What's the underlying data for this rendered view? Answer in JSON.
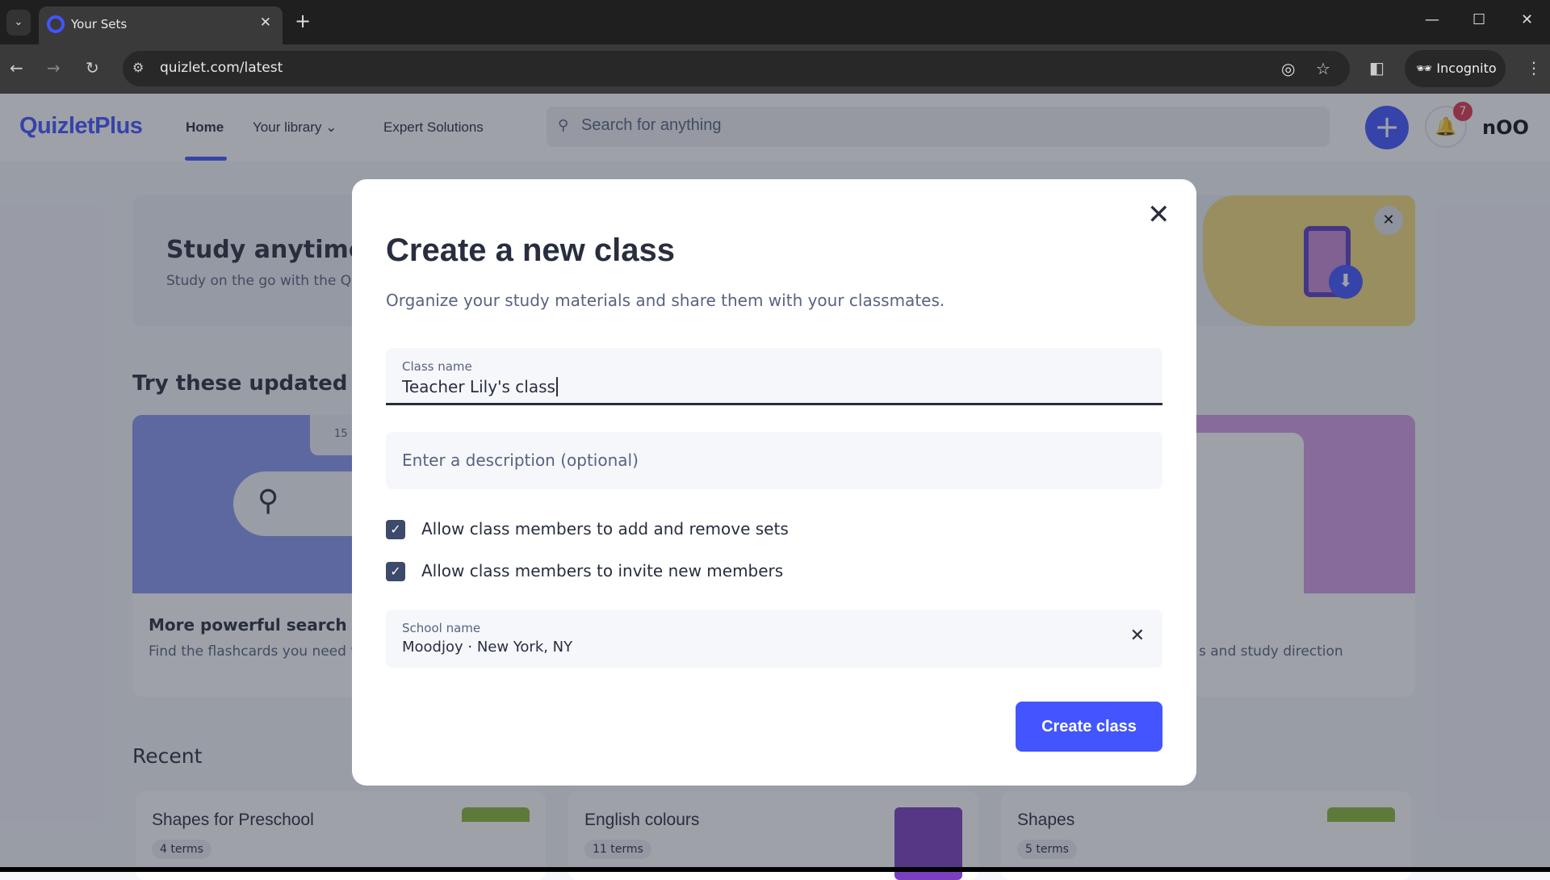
{
  "browser": {
    "tab_title": "Your Sets",
    "url": "quizlet.com/latest",
    "incognito_label": "Incognito"
  },
  "header": {
    "logo": "QuizletPlus",
    "nav": [
      "Home",
      "Your library",
      "Expert Solutions"
    ],
    "search_placeholder": "Search for anything",
    "notification_count": "7",
    "avatar": "nOO"
  },
  "page": {
    "banner": {
      "title": "Study anytime, a",
      "subtitle": "Study on the go with the Qu"
    },
    "features_heading": "Try these updated feat",
    "features": [
      {
        "title": "More powerful search",
        "desc": "Find the flashcards you need t",
        "badge": "15"
      },
      {
        "title": "",
        "desc": ""
      },
      {
        "title": "",
        "desc": "s and study direction"
      }
    ],
    "recent_heading": "Recent",
    "recent": [
      {
        "title": "Shapes for Preschool",
        "count": "4 terms"
      },
      {
        "title": "English colours",
        "count": "11 terms"
      },
      {
        "title": "Shapes",
        "count": "5 terms"
      }
    ]
  },
  "modal": {
    "title": "Create a new class",
    "subtitle": "Organize your study materials and share them with your classmates.",
    "class_name_label": "Class name",
    "class_name_value": "Teacher Lily's class",
    "description_placeholder": "Enter a description (optional)",
    "checkboxes": [
      {
        "label": "Allow class members to add and remove sets",
        "checked": true
      },
      {
        "label": "Allow class members to invite new members",
        "checked": true
      }
    ],
    "school_label": "School name",
    "school_value": "Moodjoy · New York, NY",
    "create_label": "Create class"
  },
  "colors": {
    "accent": "#4255ff",
    "text": "#282e3e",
    "muted": "#586380"
  }
}
